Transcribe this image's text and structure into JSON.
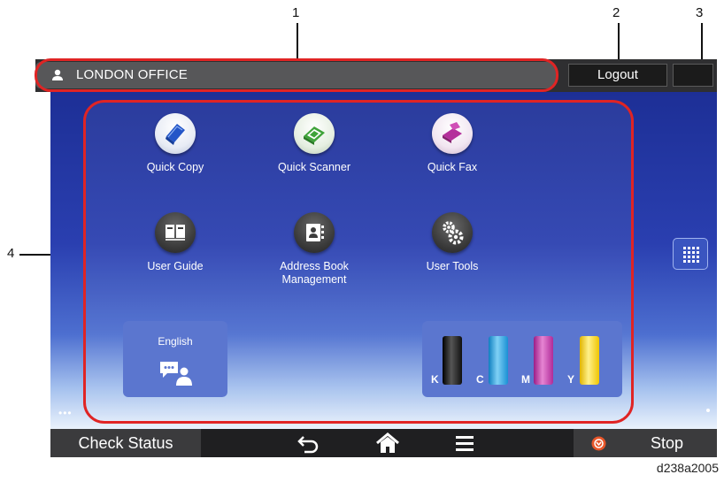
{
  "callouts": {
    "c1": "1",
    "c2": "2",
    "c3": "3",
    "c4": "4"
  },
  "header": {
    "user_name": "LONDON OFFICE",
    "logout_label": "Logout"
  },
  "apps": [
    {
      "label": "Quick Copy",
      "icon": "copy-icon"
    },
    {
      "label": "Quick Scanner",
      "icon": "scanner-icon"
    },
    {
      "label": "Quick Fax",
      "icon": "fax-icon"
    },
    {
      "label": "User Guide",
      "icon": "book-icon"
    },
    {
      "label": "Address Book Management",
      "label_line1": "Address Book",
      "label_line2": "Management",
      "icon": "address-book-icon"
    },
    {
      "label": "User Tools",
      "icon": "gears-icon"
    }
  ],
  "language_widget": {
    "label": "English",
    "icon": "language-user-icon"
  },
  "toner": [
    {
      "letter": "K",
      "color": "#1a1a1a"
    },
    {
      "letter": "C",
      "color": "#1f9fd9"
    },
    {
      "letter": "M",
      "color": "#c12fa8"
    },
    {
      "letter": "Y",
      "color": "#f3cf1d"
    }
  ],
  "bottom_bar": {
    "check_status_label": "Check Status",
    "stop_label": "Stop"
  },
  "figure_code": "d238a2005",
  "colors": {
    "callout": "#e02424",
    "screen_top": "#1d2f96",
    "stop_icon": "#e8562a"
  }
}
